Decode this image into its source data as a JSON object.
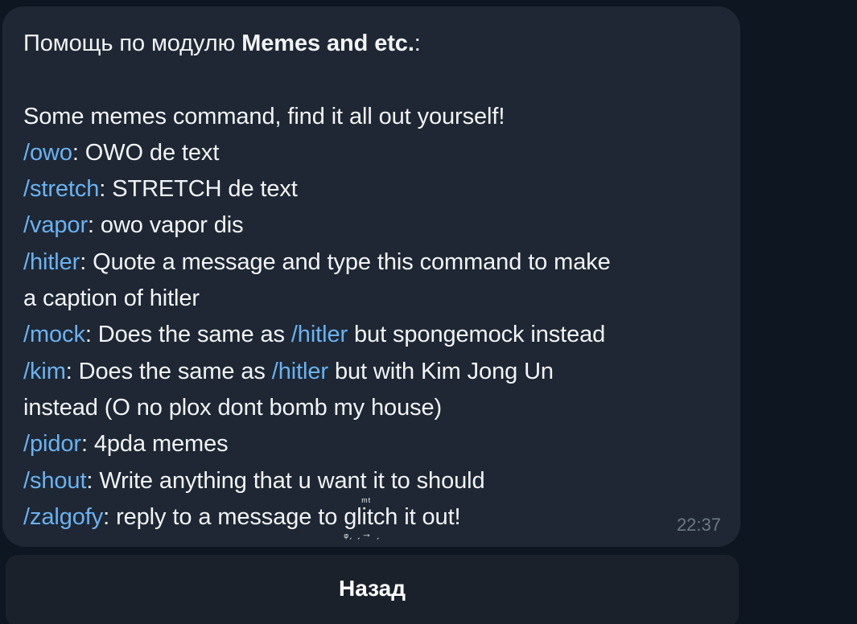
{
  "message": {
    "header_prefix": "Помощь по модулю ",
    "module_name": "Memes and etc.",
    "header_suffix": ":",
    "intro": "Some memes command, find it all out yourself!",
    "commands": [
      {
        "cmd": "/owo",
        "desc": ": OWO de text"
      },
      {
        "cmd": "/stretch",
        "desc": ": STRETCH de text"
      },
      {
        "cmd": "/vapor",
        "desc": ": owo vapor dis"
      },
      {
        "cmd": "/hitler",
        "desc_line1": ": Quote a message and type this command to make",
        "desc_line2": "a caption of hitler"
      },
      {
        "cmd": "/mock",
        "desc_a": ": Does the same as ",
        "ref": "/hitler",
        "desc_b": " but spongemock instead"
      },
      {
        "cmd": "/kim",
        "desc_a": ": Does the same as ",
        "ref": "/hitler",
        "desc_b": " but with Kim Jong Un",
        "desc_line2": "instead (O no plox dont bomb my house)"
      },
      {
        "cmd": "/pidor",
        "desc": ": 4pda memes"
      },
      {
        "cmd": "/shout",
        "desc": ": Write anything that u want it to should"
      },
      {
        "cmd": "/zalgofy",
        "desc_a": ": reply to a message to ",
        "glitch_word": "glitch",
        "desc_b": " it out!"
      }
    ],
    "time": "22:37"
  },
  "button": {
    "label": "Назад"
  },
  "colors": {
    "background": "#0e1621",
    "bubble": "#1e2733",
    "link": "#6ab2f2",
    "text": "#f2f4f6",
    "time": "#6d7883"
  }
}
